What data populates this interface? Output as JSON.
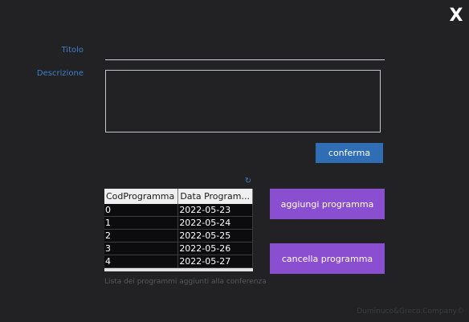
{
  "window": {
    "close_label": "X"
  },
  "form": {
    "title_label": "Titolo",
    "title_value": "",
    "description_label": "Descrizione",
    "description_value": "",
    "confirm_label": "conferma"
  },
  "table": {
    "refresh_icon": "refresh-icon",
    "columns": [
      "CodProgramma",
      "Data Program..."
    ],
    "rows": [
      [
        "0",
        "2022-05-23"
      ],
      [
        "1",
        "2022-05-24"
      ],
      [
        "2",
        "2022-05-25"
      ],
      [
        "3",
        "2022-05-26"
      ],
      [
        "4",
        "2022-05-27"
      ]
    ],
    "caption": "Lista dei programmi aggiunti alla conferenza"
  },
  "actions": {
    "add_label": "aggiungi programma",
    "delete_label": "cancella programma"
  },
  "footer": {
    "copyright": "Duminuco&Greco.Company©"
  },
  "colors": {
    "background": "#222224",
    "label_blue": "#3f7ec8",
    "confirm_blue": "#2f6db5",
    "action_purple": "#8a4fd0"
  }
}
